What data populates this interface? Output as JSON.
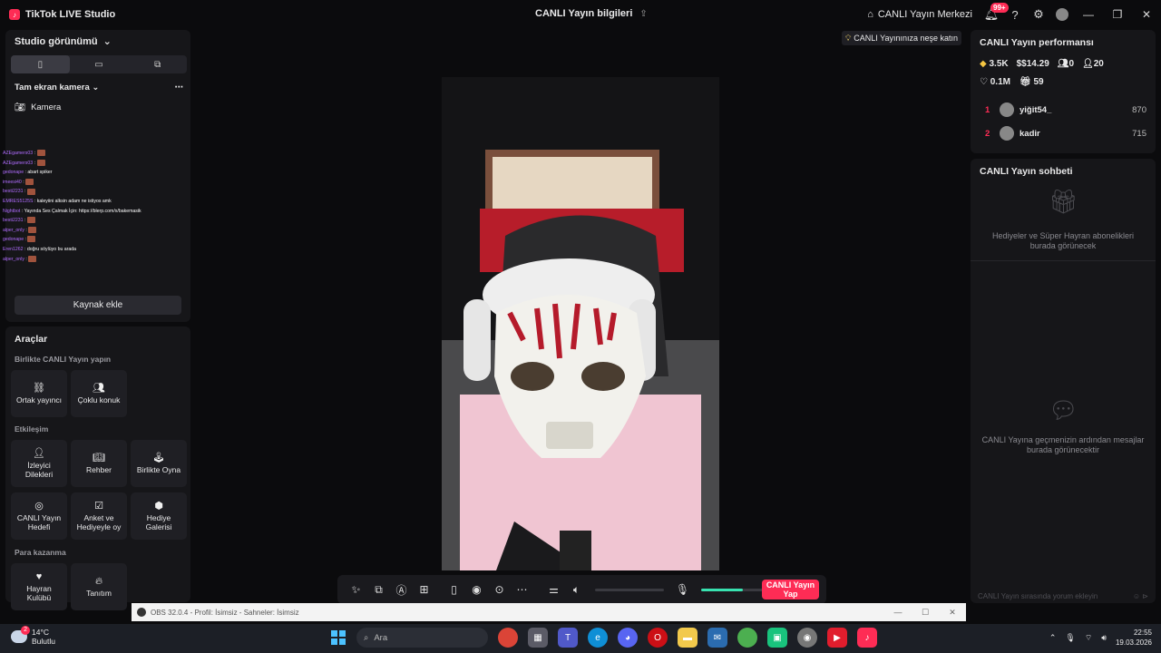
{
  "app": {
    "title": "TikTok LIVE Studio",
    "center_title": "CANLI Yayın bilgileri",
    "live_center": "CANLI Yayın Merkezi",
    "notif_count": "99+"
  },
  "left": {
    "studio_view": "Studio görünümü",
    "scene": "Tam ekran kamera",
    "camera": "Kamera",
    "add_source": "Kaynak ekle",
    "chat_overlay": [
      {
        "name": "AZEgamers03",
        "msg": ""
      },
      {
        "name": "AZEgamers03",
        "msg": ""
      },
      {
        "name": "gedonape",
        "msg": "abart spiker"
      },
      {
        "name": "imeesi40",
        "msg": ""
      },
      {
        "name": "besti2231",
        "msg": ""
      },
      {
        "name": "EMRES5125S",
        "msg": "kaleyiini alksin adam ne istiyos amk"
      },
      {
        "name": "Nightbot",
        "msg": "Yayında Ses Çalmak İçin: https://blerp.com/x/bakemasik"
      },
      {
        "name": "besti2231",
        "msg": ""
      },
      {
        "name": "alper_only",
        "msg": ""
      },
      {
        "name": "gedonape",
        "msg": ""
      },
      {
        "name": "Eren1262",
        "msg": "doğru söylüyo bu arada"
      },
      {
        "name": "alper_only",
        "msg": ""
      }
    ],
    "tools_title": "Araçlar",
    "together_title": "Birlikte CANLI Yayın yapın",
    "interaction_title": "Etkileşim",
    "earn_title": "Para kazanma",
    "tools": {
      "co_host": "Ortak yayıncı",
      "multi_guest": "Çoklu konuk",
      "viewer_requests": "İzleyici Dilekleri",
      "guide": "Rehber",
      "play_together": "Birlikte Oyna",
      "live_goal": "CANLI Yayın Hedefi",
      "poll": "Anket ve Hediyeyle oy",
      "gift_gallery": "Hediye Galerisi",
      "fan_club": "Hayran Kulübü",
      "promote": "Tanıtım"
    }
  },
  "stage": {
    "tip": "CANLI Yayınınıza neşe katın",
    "go_live": "CANLI Yayın Yap",
    "mic_level": 0.6
  },
  "right": {
    "perf_title": "CANLI Yayın performansı",
    "stats": {
      "diamonds": "3.5K",
      "earnings": "$14.29",
      "viewers": "0",
      "followers": "20",
      "likes": "0.1M",
      "gifts": "59"
    },
    "ranking": [
      {
        "rank": "1",
        "name": "yiğit54_",
        "score": "870"
      },
      {
        "rank": "2",
        "name": "kadir",
        "score": "715"
      }
    ],
    "chat_title": "CANLI Yayın sohbeti",
    "gifts_empty": "Hediyeler ve Süper Hayran abonelikleri burada görünecek",
    "chat_empty": "CANLI Yayına geçmenizin ardından mesajlar burada görünecektir",
    "chat_placeholder": "CANLI Yayın sırasında yorum ekleyin"
  },
  "obs": {
    "title": "OBS 32.0.4 - Profil: İsimsiz - Sahneler: İsimsiz"
  },
  "taskbar": {
    "temp": "14°C",
    "weather": "Bulutlu",
    "weather_badge": "2",
    "search": "Ara",
    "time": "22:55",
    "date": "19.03.2026"
  }
}
